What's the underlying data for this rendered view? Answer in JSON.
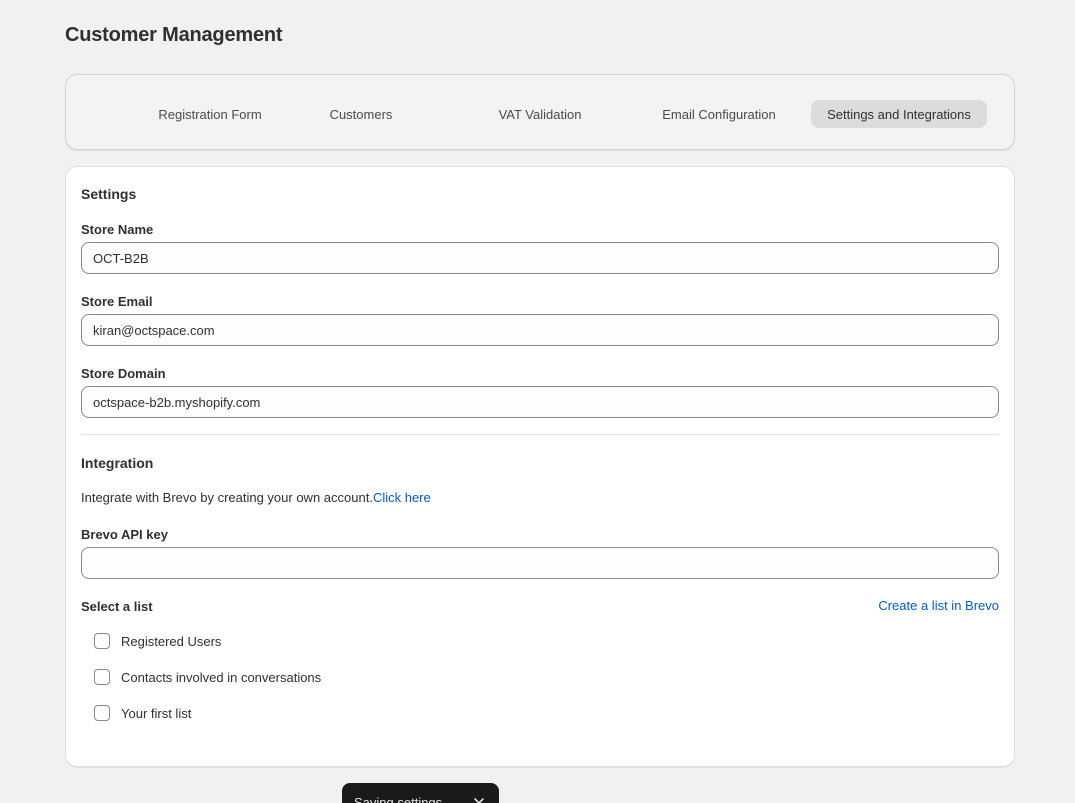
{
  "page": {
    "title": "Customer Management"
  },
  "tabs": [
    {
      "label": "Registration Form"
    },
    {
      "label": "Customers"
    },
    {
      "label": "VAT Validation"
    },
    {
      "label": "Email Configuration"
    },
    {
      "label": "Settings and Integrations",
      "active": true
    }
  ],
  "settings": {
    "title": "Settings",
    "store_name": {
      "label": "Store Name",
      "value": "OCT-B2B"
    },
    "store_email": {
      "label": "Store Email",
      "value": "kiran@octspace.com"
    },
    "store_domain": {
      "label": "Store Domain",
      "value": "octspace-b2b.myshopify.com"
    }
  },
  "integration": {
    "title": "Integration",
    "intro_text": "Integrate with Brevo by creating your own account.",
    "intro_link": "Click here",
    "api_key": {
      "label": "Brevo API key",
      "value": ""
    },
    "list_label": "Select a list",
    "create_list_link": "Create a list in Brevo",
    "lists": [
      {
        "label": "Registered Users",
        "checked": false
      },
      {
        "label": "Contacts involved in conversations",
        "checked": false
      },
      {
        "label": "Your first list",
        "checked": false
      }
    ]
  },
  "toast": {
    "text": "Saving settings",
    "icon": "close-icon"
  },
  "colors": {
    "accent_link": "#005bd3",
    "background": "#f1f1f1",
    "toast_bg": "#1a1a1a"
  }
}
